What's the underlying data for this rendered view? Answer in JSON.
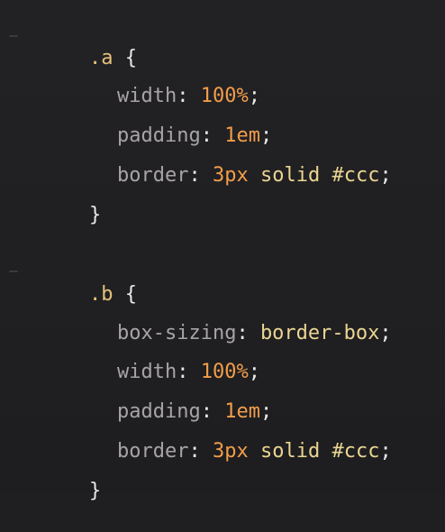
{
  "editor": {
    "blocks": [
      {
        "selector": ".a",
        "open_brace": "{",
        "close_brace": "}",
        "declarations": [
          {
            "property": "width",
            "values": [
              {
                "text": "100%",
                "kind": "num"
              }
            ]
          },
          {
            "property": "padding",
            "values": [
              {
                "text": "1em",
                "kind": "num"
              }
            ]
          },
          {
            "property": "border",
            "values": [
              {
                "text": "3px",
                "kind": "num"
              },
              {
                "text": "solid",
                "kind": "ident"
              },
              {
                "text": "#ccc",
                "kind": "ident"
              }
            ]
          }
        ]
      },
      {
        "selector": ".b",
        "open_brace": "{",
        "close_brace": "}",
        "declarations": [
          {
            "property": "box-sizing",
            "values": [
              {
                "text": "border-box",
                "kind": "ident"
              }
            ]
          },
          {
            "property": "width",
            "values": [
              {
                "text": "100%",
                "kind": "num"
              }
            ]
          },
          {
            "property": "padding",
            "values": [
              {
                "text": "1em",
                "kind": "num"
              }
            ]
          },
          {
            "property": "border",
            "values": [
              {
                "text": "3px",
                "kind": "num"
              },
              {
                "text": "solid",
                "kind": "ident"
              },
              {
                "text": "#ccc",
                "kind": "ident"
              }
            ]
          }
        ]
      }
    ],
    "colors": {
      "background": "#1f1f21",
      "selector": "#e6c07b",
      "property": "#a8a3a6",
      "number": "#f29d49",
      "identifier": "#ebd592",
      "punctuation": "#e8e8e8"
    }
  }
}
